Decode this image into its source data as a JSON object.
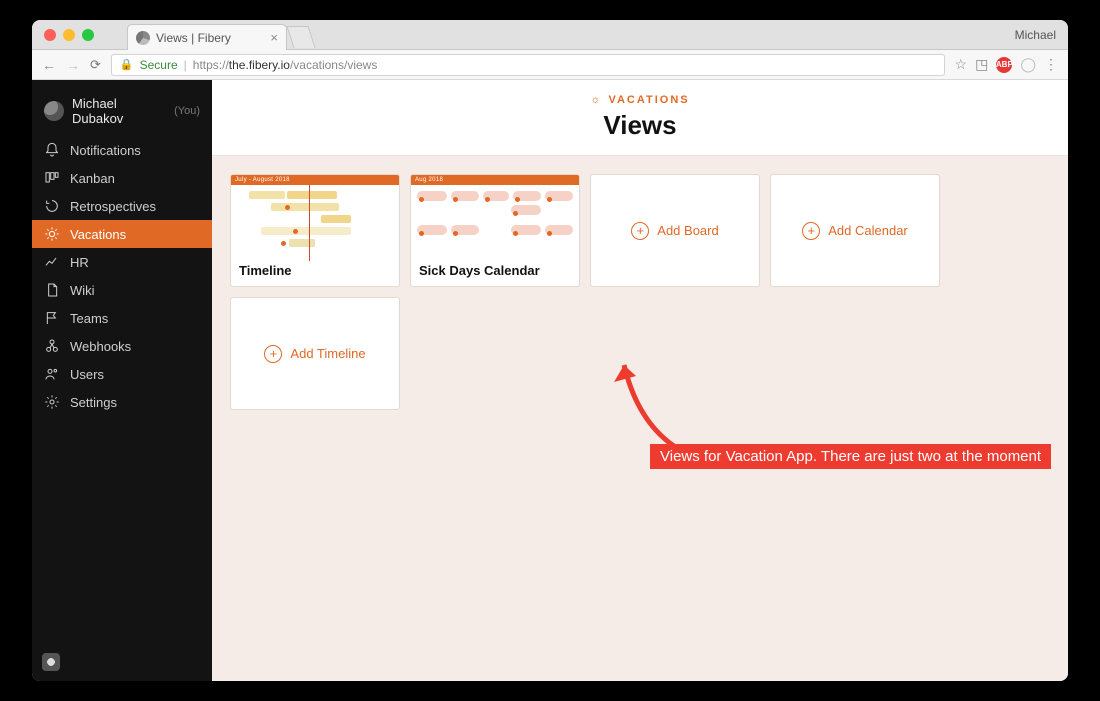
{
  "chrome": {
    "tab_title": "Views | Fibery",
    "user_label": "Michael",
    "secure_label": "Secure",
    "url_host": "https://",
    "url_domain": "the.fibery.io",
    "url_path": "/vacations/views"
  },
  "sidebar": {
    "user": {
      "name": "Michael Dubakov",
      "you": "(You)"
    },
    "items": [
      {
        "label": "Notifications"
      },
      {
        "label": "Kanban"
      },
      {
        "label": "Retrospectives"
      },
      {
        "label": "Vacations"
      },
      {
        "label": "HR"
      },
      {
        "label": "Wiki"
      },
      {
        "label": "Teams"
      },
      {
        "label": "Webhooks"
      },
      {
        "label": "Users"
      },
      {
        "label": "Settings"
      }
    ]
  },
  "header": {
    "label": "VACATIONS",
    "title": "Views"
  },
  "cards": {
    "timeline": {
      "title": "Timeline",
      "subhead": "July - August 2018"
    },
    "calendar": {
      "title": "Sick Days Calendar",
      "subhead": "Aug 2018"
    },
    "add_board": "Add Board",
    "add_calendar": "Add Calendar",
    "add_timeline": "Add Timeline"
  },
  "annotation": {
    "text": "Views for Vacation App. There are just two at the moment"
  }
}
